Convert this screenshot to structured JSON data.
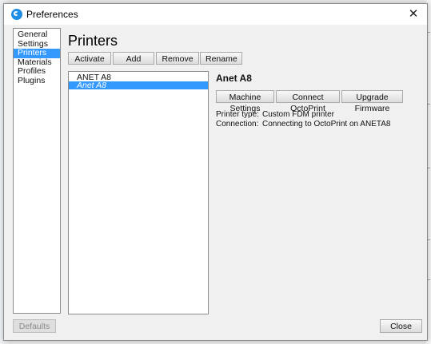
{
  "window": {
    "title": "Preferences"
  },
  "nav": {
    "items": [
      {
        "label": "General",
        "selected": false
      },
      {
        "label": "Settings",
        "selected": false
      },
      {
        "label": "Printers",
        "selected": true
      },
      {
        "label": "Materials",
        "selected": false
      },
      {
        "label": "Profiles",
        "selected": false
      },
      {
        "label": "Plugins",
        "selected": false
      }
    ]
  },
  "page": {
    "title": "Printers",
    "toolbar": {
      "activate": "Activate",
      "add": "Add",
      "remove": "Remove",
      "rename": "Rename"
    }
  },
  "printers": {
    "items": [
      {
        "name": "ANET A8",
        "selected": false
      },
      {
        "name": "Anet A8",
        "selected": true
      }
    ]
  },
  "details": {
    "name": "Anet A8",
    "buttons": {
      "machine_settings": "Machine Settings",
      "connect_octoprint": "Connect OctoPrint",
      "upgrade_firmware": "Upgrade Firmware"
    },
    "printer_type_label": "Printer type:",
    "printer_type_value": "Custom FDM printer",
    "connection_label": "Connection:",
    "connection_value": "Connecting to OctoPrint on ANETA8"
  },
  "footer": {
    "defaults": "Defaults",
    "close": "Close"
  },
  "colors": {
    "selection": "#3399ff",
    "window_bg": "#f0f0f0",
    "app_icon": "#1d8ee3"
  }
}
